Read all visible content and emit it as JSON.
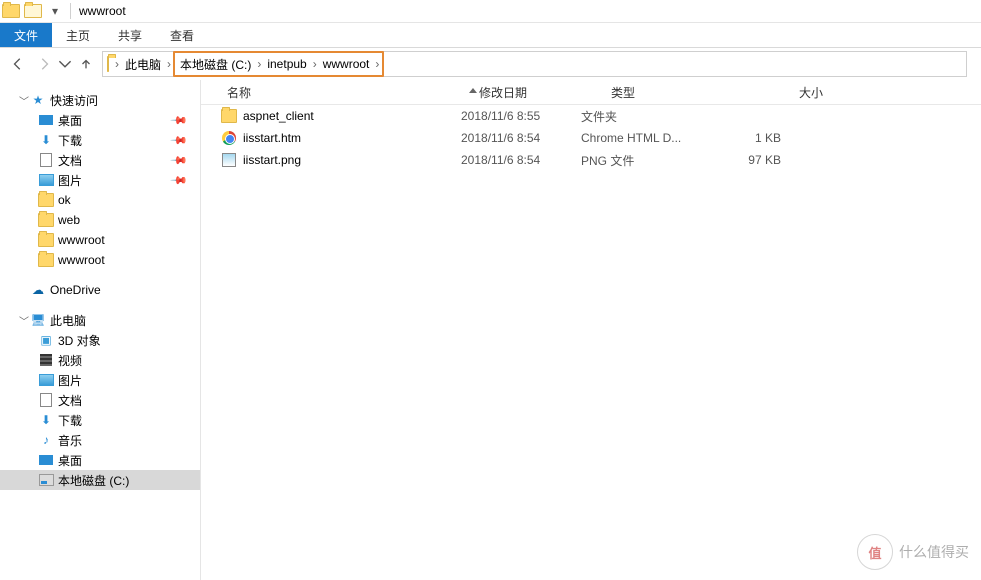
{
  "title": "wwwroot",
  "ribbon": {
    "file": "文件",
    "home": "主页",
    "share": "共享",
    "view": "查看"
  },
  "breadcrumb": {
    "root": "此电脑",
    "disk": "本地磁盘 (C:)",
    "p1": "inetpub",
    "p2": "wwwroot"
  },
  "columns": {
    "name": "名称",
    "date": "修改日期",
    "type": "类型",
    "size": "大小"
  },
  "sidebar": {
    "quick": "快速访问",
    "desktop": "桌面",
    "downloads": "下载",
    "documents": "文档",
    "pictures": "图片",
    "ok": "ok",
    "web": "web",
    "wwwroot1": "wwwroot",
    "wwwroot2": "wwwroot",
    "onedrive": "OneDrive",
    "thispc": "此电脑",
    "obj3d": "3D 对象",
    "videos": "视频",
    "pictures2": "图片",
    "documents2": "文档",
    "downloads2": "下载",
    "music": "音乐",
    "desktop2": "桌面",
    "diskc": "本地磁盘 (C:)"
  },
  "files": [
    {
      "name": "aspnet_client",
      "date": "2018/11/6 8:55",
      "type": "文件夹",
      "size": "",
      "icon": "folder"
    },
    {
      "name": "iisstart.htm",
      "date": "2018/11/6 8:54",
      "type": "Chrome HTML D...",
      "size": "1 KB",
      "icon": "chrome"
    },
    {
      "name": "iisstart.png",
      "date": "2018/11/6 8:54",
      "type": "PNG 文件",
      "size": "97 KB",
      "icon": "png"
    }
  ],
  "watermark": "什么值得买"
}
